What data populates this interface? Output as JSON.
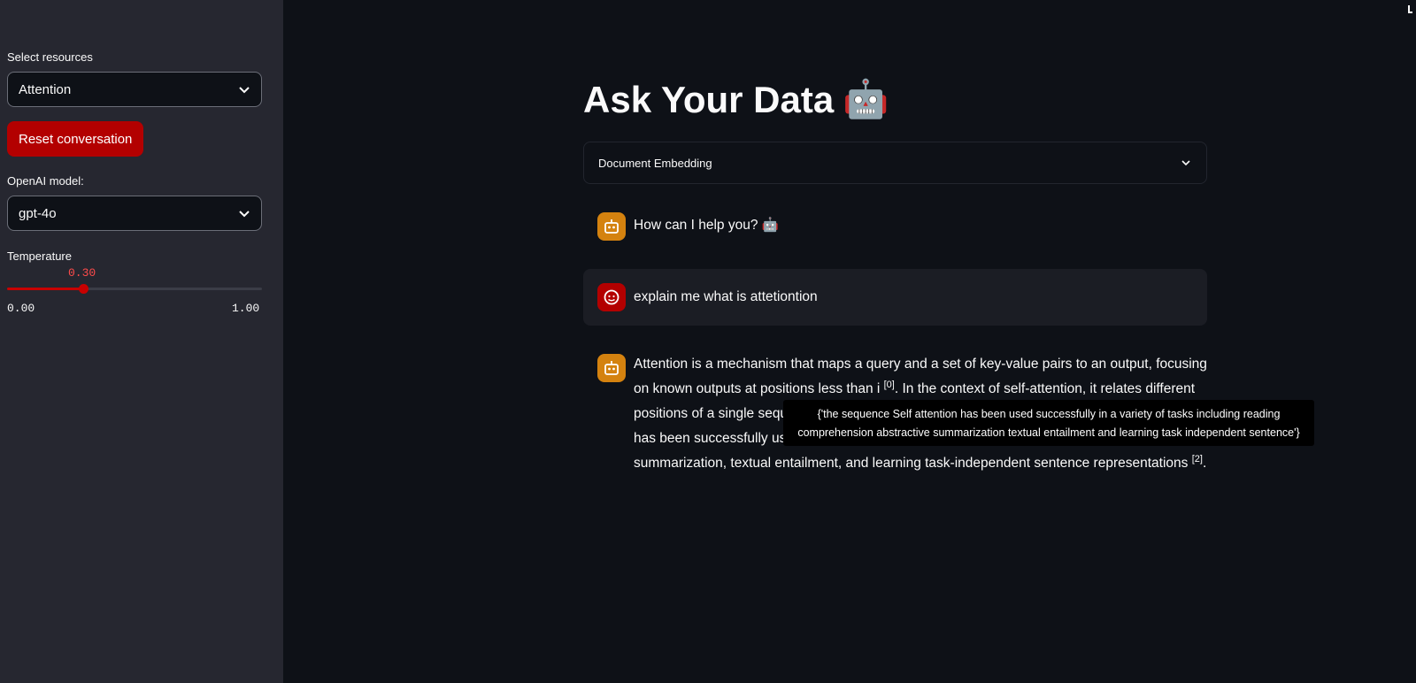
{
  "sidebar": {
    "resources_label": "Select resources",
    "resources_value": "Attention",
    "reset_button": "Reset conversation",
    "model_label": "OpenAI model:",
    "model_value": "gpt-4o",
    "temperature": {
      "label": "Temperature",
      "value_text": "0.30",
      "value": 0.3,
      "min_text": "0.00",
      "max_text": "1.00",
      "accent": "#ff4b4b"
    }
  },
  "main": {
    "title": "Ask Your Data",
    "title_emoji": "🤖",
    "expander_label": "Document Embedding",
    "messages": [
      {
        "role": "assistant",
        "text": "How can I help you? 🤖"
      },
      {
        "role": "user",
        "text": "explain me what is attetiontion"
      },
      {
        "role": "assistant",
        "part1": "Attention is a mechanism that maps a query and a set of key-value pairs to an output, focusing on known outputs at positions less than i ",
        "ref0": "[0]",
        "part2": ". In the context of self-attention, it relates different positions of a single sequence to compute a representation of the sequence. Self-attention has been successfully used in a variety of tasks including reading comprehension, abstractive summarization, textual entailment, and learning task-independent sentence representations ",
        "ref2": "[2]",
        "part3": "."
      }
    ],
    "tooltip": "{'the sequence Self attention has been used successfully in a variety of tasks including reading comprehension abstractive summarization textual entailment and learning task independent sentence'}"
  },
  "colors": {
    "background": "#0e1117",
    "sidebar": "#262730",
    "primary": "#b30000",
    "assistant_avatar": "#d4820f"
  }
}
